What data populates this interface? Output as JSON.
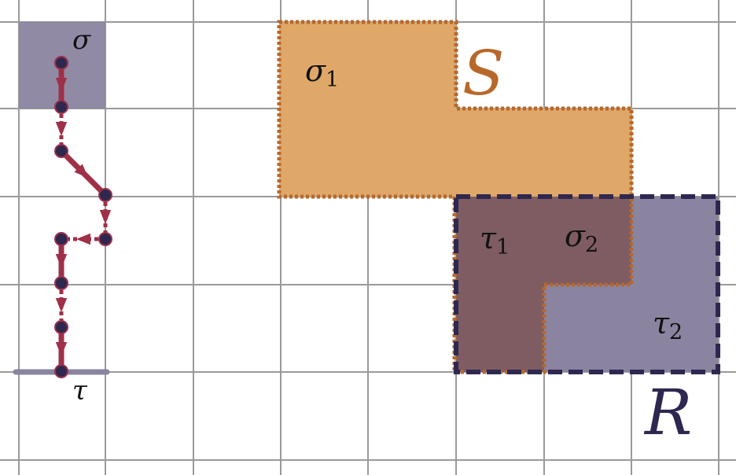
{
  "colors": {
    "grid": "#9a9a9a",
    "s_fill": "#e0a868",
    "s_stroke": "#b8682a",
    "r_fill": "#8a84a0",
    "r_stroke": "#2e2850",
    "overlap_fill": "#7e5c62",
    "sigma_fill": "#8a84a0",
    "path": "#9e3048",
    "node": "#2e2850"
  },
  "labels": {
    "sigma": "σ",
    "tau": "τ",
    "S": "S",
    "R": "R",
    "sigma1_base": "σ",
    "sigma1_sub": "1",
    "sigma2_base": "σ",
    "sigma2_sub": "2",
    "tau1_base": "τ",
    "tau1_sub": "1",
    "tau2_base": "τ",
    "tau2_sub": "2"
  }
}
